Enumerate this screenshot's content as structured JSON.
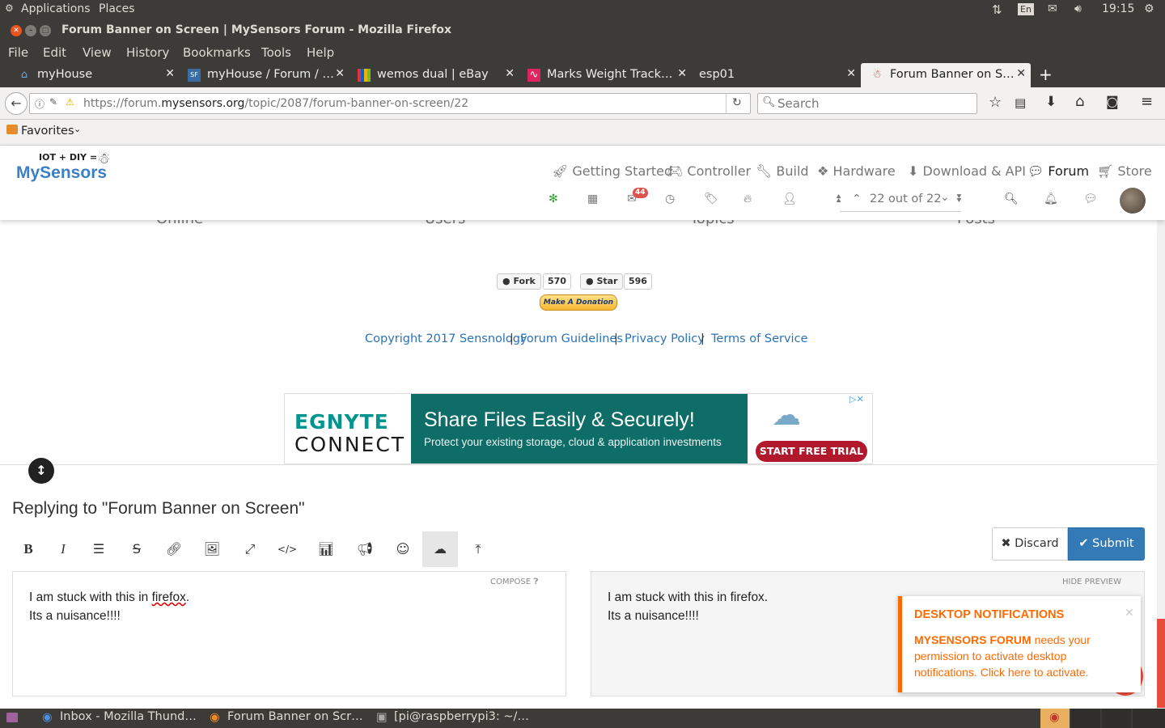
{
  "panel": {
    "applications": "Applications",
    "places": "Places",
    "lang": "En",
    "time": "19:15"
  },
  "window": {
    "title": "Forum Banner on Screen | MySensors Forum - Mozilla Firefox"
  },
  "menu": {
    "file": "File",
    "edit": "Edit",
    "view": "View",
    "history": "History",
    "bookmarks": "Bookmarks",
    "tools": "Tools",
    "help": "Help"
  },
  "tabs": [
    {
      "label": "myHouse"
    },
    {
      "label": "myHouse / Forum / …"
    },
    {
      "label": "wemos dual | eBay"
    },
    {
      "label": "Marks Weight Track…"
    },
    {
      "label": "esp01"
    },
    {
      "label": "Forum Banner on S…"
    }
  ],
  "url": {
    "prefix": "https://forum.",
    "domain": "mysensors.org",
    "path": "/topic/2087/forum-banner-on-screen/22"
  },
  "search": {
    "placeholder": "Search"
  },
  "favorites": {
    "label": "Favorites"
  },
  "site": {
    "logo_top": "IOT + DIY =",
    "logo_main": "MySensors",
    "nav": [
      "Getting Started",
      "Controller",
      "Build",
      "Hardware",
      "Download & API",
      "Forum",
      "Store"
    ],
    "notif_count": "44",
    "pagination": "22 out of 22",
    "stats_labels": [
      "Online",
      "Users",
      "Topics",
      "Posts"
    ]
  },
  "github": {
    "fork": "Fork",
    "fork_count": "570",
    "star": "Star",
    "star_count": "596"
  },
  "donate": "Make A Donation",
  "footer_links": [
    "Copyright 2017 Sensnology",
    "Forum Guidelines",
    "Privacy Policy",
    "Terms of Service"
  ],
  "ad": {
    "brand_top": "EGNYTE",
    "brand_bottom": "CONNECT",
    "headline": "Share Files Easily & Securely!",
    "sub": "Protect your existing storage, cloud & application investments",
    "cta": "START FREE TRIAL"
  },
  "composer": {
    "title": "Replying to \"Forum Banner on Screen\"",
    "discard": "Discard",
    "submit": "Submit",
    "compose_label": "COMPOSE",
    "hide_preview": "HIDE PREVIEW",
    "line1_pre": "I am stuck with this in ",
    "line1_word": "firefox",
    "line1_post": ".",
    "line2": "Its a nuisance!!!!",
    "preview_line1": "I am stuck with this in firefox.",
    "preview_line2": "Its a nuisance!!!!"
  },
  "notification": {
    "title": "DESKTOP NOTIFICATIONS",
    "bold": "MYSENSORS FORUM",
    "text": " needs your permission to activate desktop notifications. Click here to activate."
  },
  "taskbar": [
    {
      "label": "Inbox - Mozilla Thund…"
    },
    {
      "label": "Forum Banner on Scr…"
    },
    {
      "label": "[pi@raspberrypi3: ~/…"
    }
  ],
  "colors": {
    "accent": "#337ab7",
    "orange": "#ff6a00",
    "ubuntu_dark": "#3c3b37"
  }
}
